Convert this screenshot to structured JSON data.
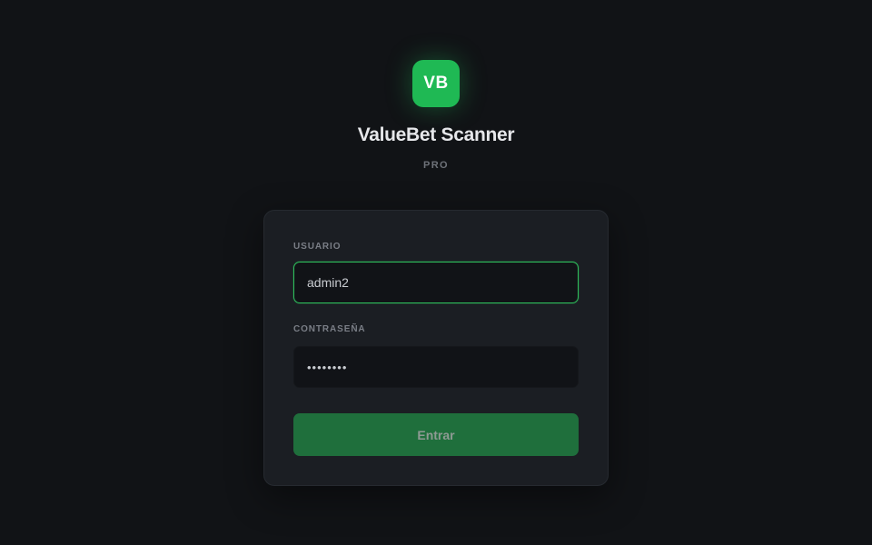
{
  "brand": {
    "logo_text": "VB",
    "title": "ValueBet Scanner",
    "tier": "PRO",
    "accent_color": "#22c55e"
  },
  "login": {
    "username_label": "USUARIO",
    "username_value": "admin2",
    "password_label": "CONTRASEÑA",
    "password_value": "••••••••",
    "submit_label": "Entrar"
  }
}
